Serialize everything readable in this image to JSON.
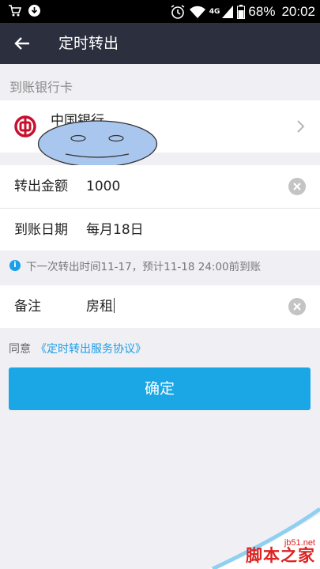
{
  "status_bar": {
    "left_icons": [
      "shopping-cart-icon",
      "download-icon"
    ],
    "network_type": "4G",
    "battery": "68%",
    "time": "20:02"
  },
  "header": {
    "title": "定时转出"
  },
  "section_title": "到账银行卡",
  "bank": {
    "name": "中国银行",
    "logo_color": "#c8102e"
  },
  "form": {
    "amount_label": "转出金额",
    "amount_value": "1000",
    "date_label": "到账日期",
    "date_value": "每月18日",
    "note_label": "备注",
    "note_value": "房租"
  },
  "info_text": "下一次转出时间11-17，预计11-18 24:00前到账",
  "agreement": {
    "prefix": "同意",
    "link": "《定时转出服务协议》"
  },
  "confirm_label": "确定",
  "watermark": {
    "site": "jb51.net",
    "name": "脚本之家"
  },
  "colors": {
    "header_bg": "#2b2f3e",
    "accent": "#1ba6e6",
    "link": "#1a9ee6",
    "page_bg": "#f0eff4"
  }
}
